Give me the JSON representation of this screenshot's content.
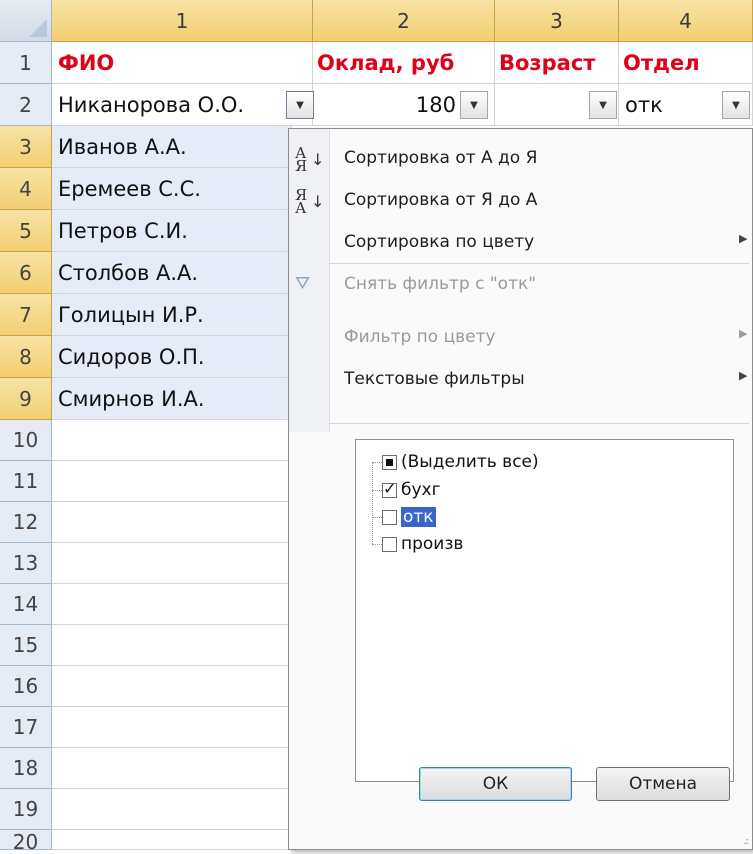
{
  "columns": [
    "1",
    "2",
    "3",
    "4"
  ],
  "rows": [
    "1",
    "2",
    "3",
    "4",
    "5",
    "6",
    "7",
    "8",
    "9",
    "10",
    "11",
    "12",
    "13",
    "14",
    "15",
    "16",
    "17",
    "18",
    "19",
    "20"
  ],
  "headers": {
    "fio": "ФИО",
    "salary": "Оклад, руб",
    "age": "Возраст",
    "dept": "Отдел"
  },
  "data_rows": [
    {
      "name": "Никанорова О.О.",
      "salary": "180",
      "dept": "отк"
    },
    {
      "name": "Иванов А.А."
    },
    {
      "name": "Еремеев С.С."
    },
    {
      "name": "Петров С.И."
    },
    {
      "name": "Столбов А.А."
    },
    {
      "name": "Голицын И.Р."
    },
    {
      "name": "Сидоров О.П."
    },
    {
      "name": "Смирнов И.А."
    }
  ],
  "menu": {
    "sort_az": "Сортировка от А до Я",
    "sort_za": "Сортировка от Я до А",
    "sort_color": "Сортировка по цвету",
    "clear_filter": "Снять фильтр с \"отк\"",
    "filter_color": "Фильтр по цвету",
    "text_filters": "Текстовые фильтры",
    "icons": {
      "sort_az": "sort-a-z-icon",
      "sort_za": "sort-z-a-icon",
      "clear": "clear-filter-icon"
    }
  },
  "filter_list": [
    {
      "label": "(Выделить все)",
      "state": "partial"
    },
    {
      "label": "бухг",
      "state": "checked"
    },
    {
      "label": "отк",
      "state": "unchecked",
      "highlighted": true
    },
    {
      "label": "произв",
      "state": "unchecked"
    }
  ],
  "buttons": {
    "ok": "ОК",
    "cancel": "Отмена"
  },
  "colors": {
    "header_text": "#e0001a",
    "selected_cell": "#e5ecf7",
    "highlight": "#3a66c9"
  }
}
